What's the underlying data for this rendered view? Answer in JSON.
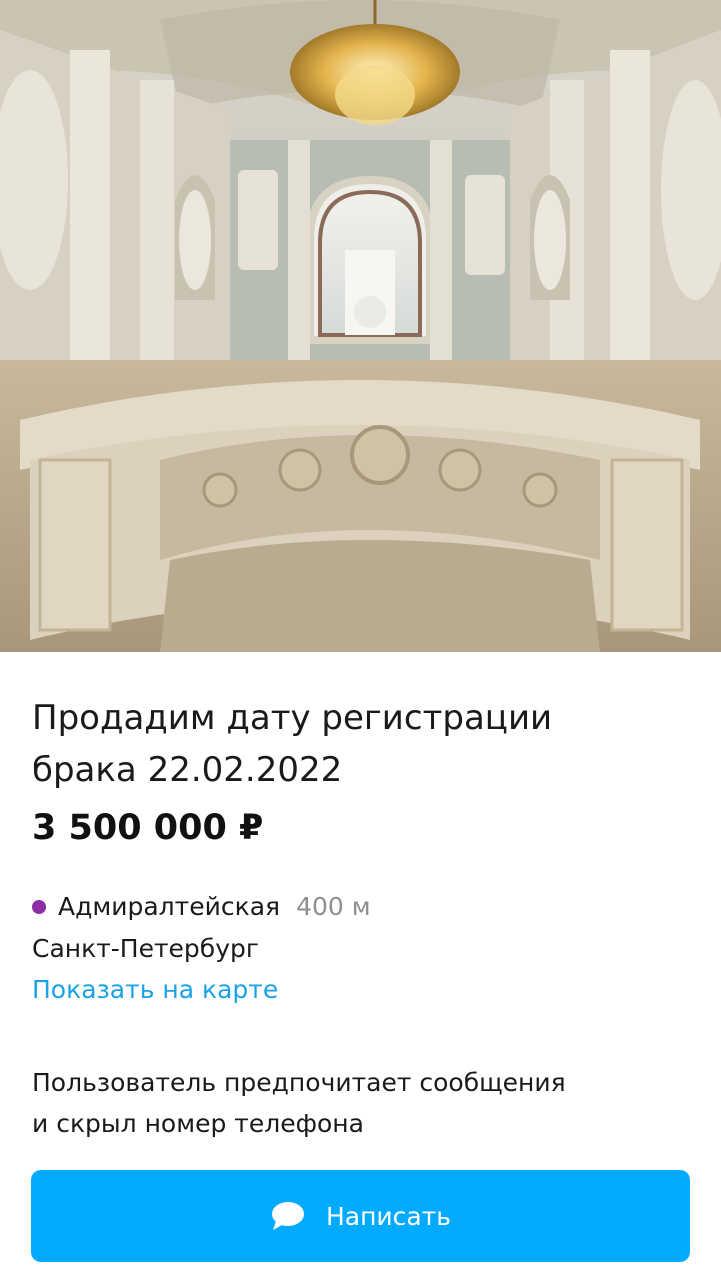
{
  "listing": {
    "title_line1": "Продадим дату регистрации",
    "title_line2": "брака 22.02.2022",
    "price": "3 500 000 ₽"
  },
  "location": {
    "metro_station": "Адмиралтейская",
    "metro_distance": "400 м",
    "metro_line_color": "#8a2ea3",
    "city": "Санкт-Петербург",
    "map_link": "Показать на карте"
  },
  "contact": {
    "note_line1": "Пользователь предпочитает сообщения",
    "note_line2": "и скрыл номер телефона",
    "write_button_label": "Написать",
    "write_button_icon": "chat-bubble-icon"
  },
  "colors": {
    "accent": "#00aaff",
    "link": "#1aa2e8",
    "secondary_text": "#8f8f8f"
  }
}
